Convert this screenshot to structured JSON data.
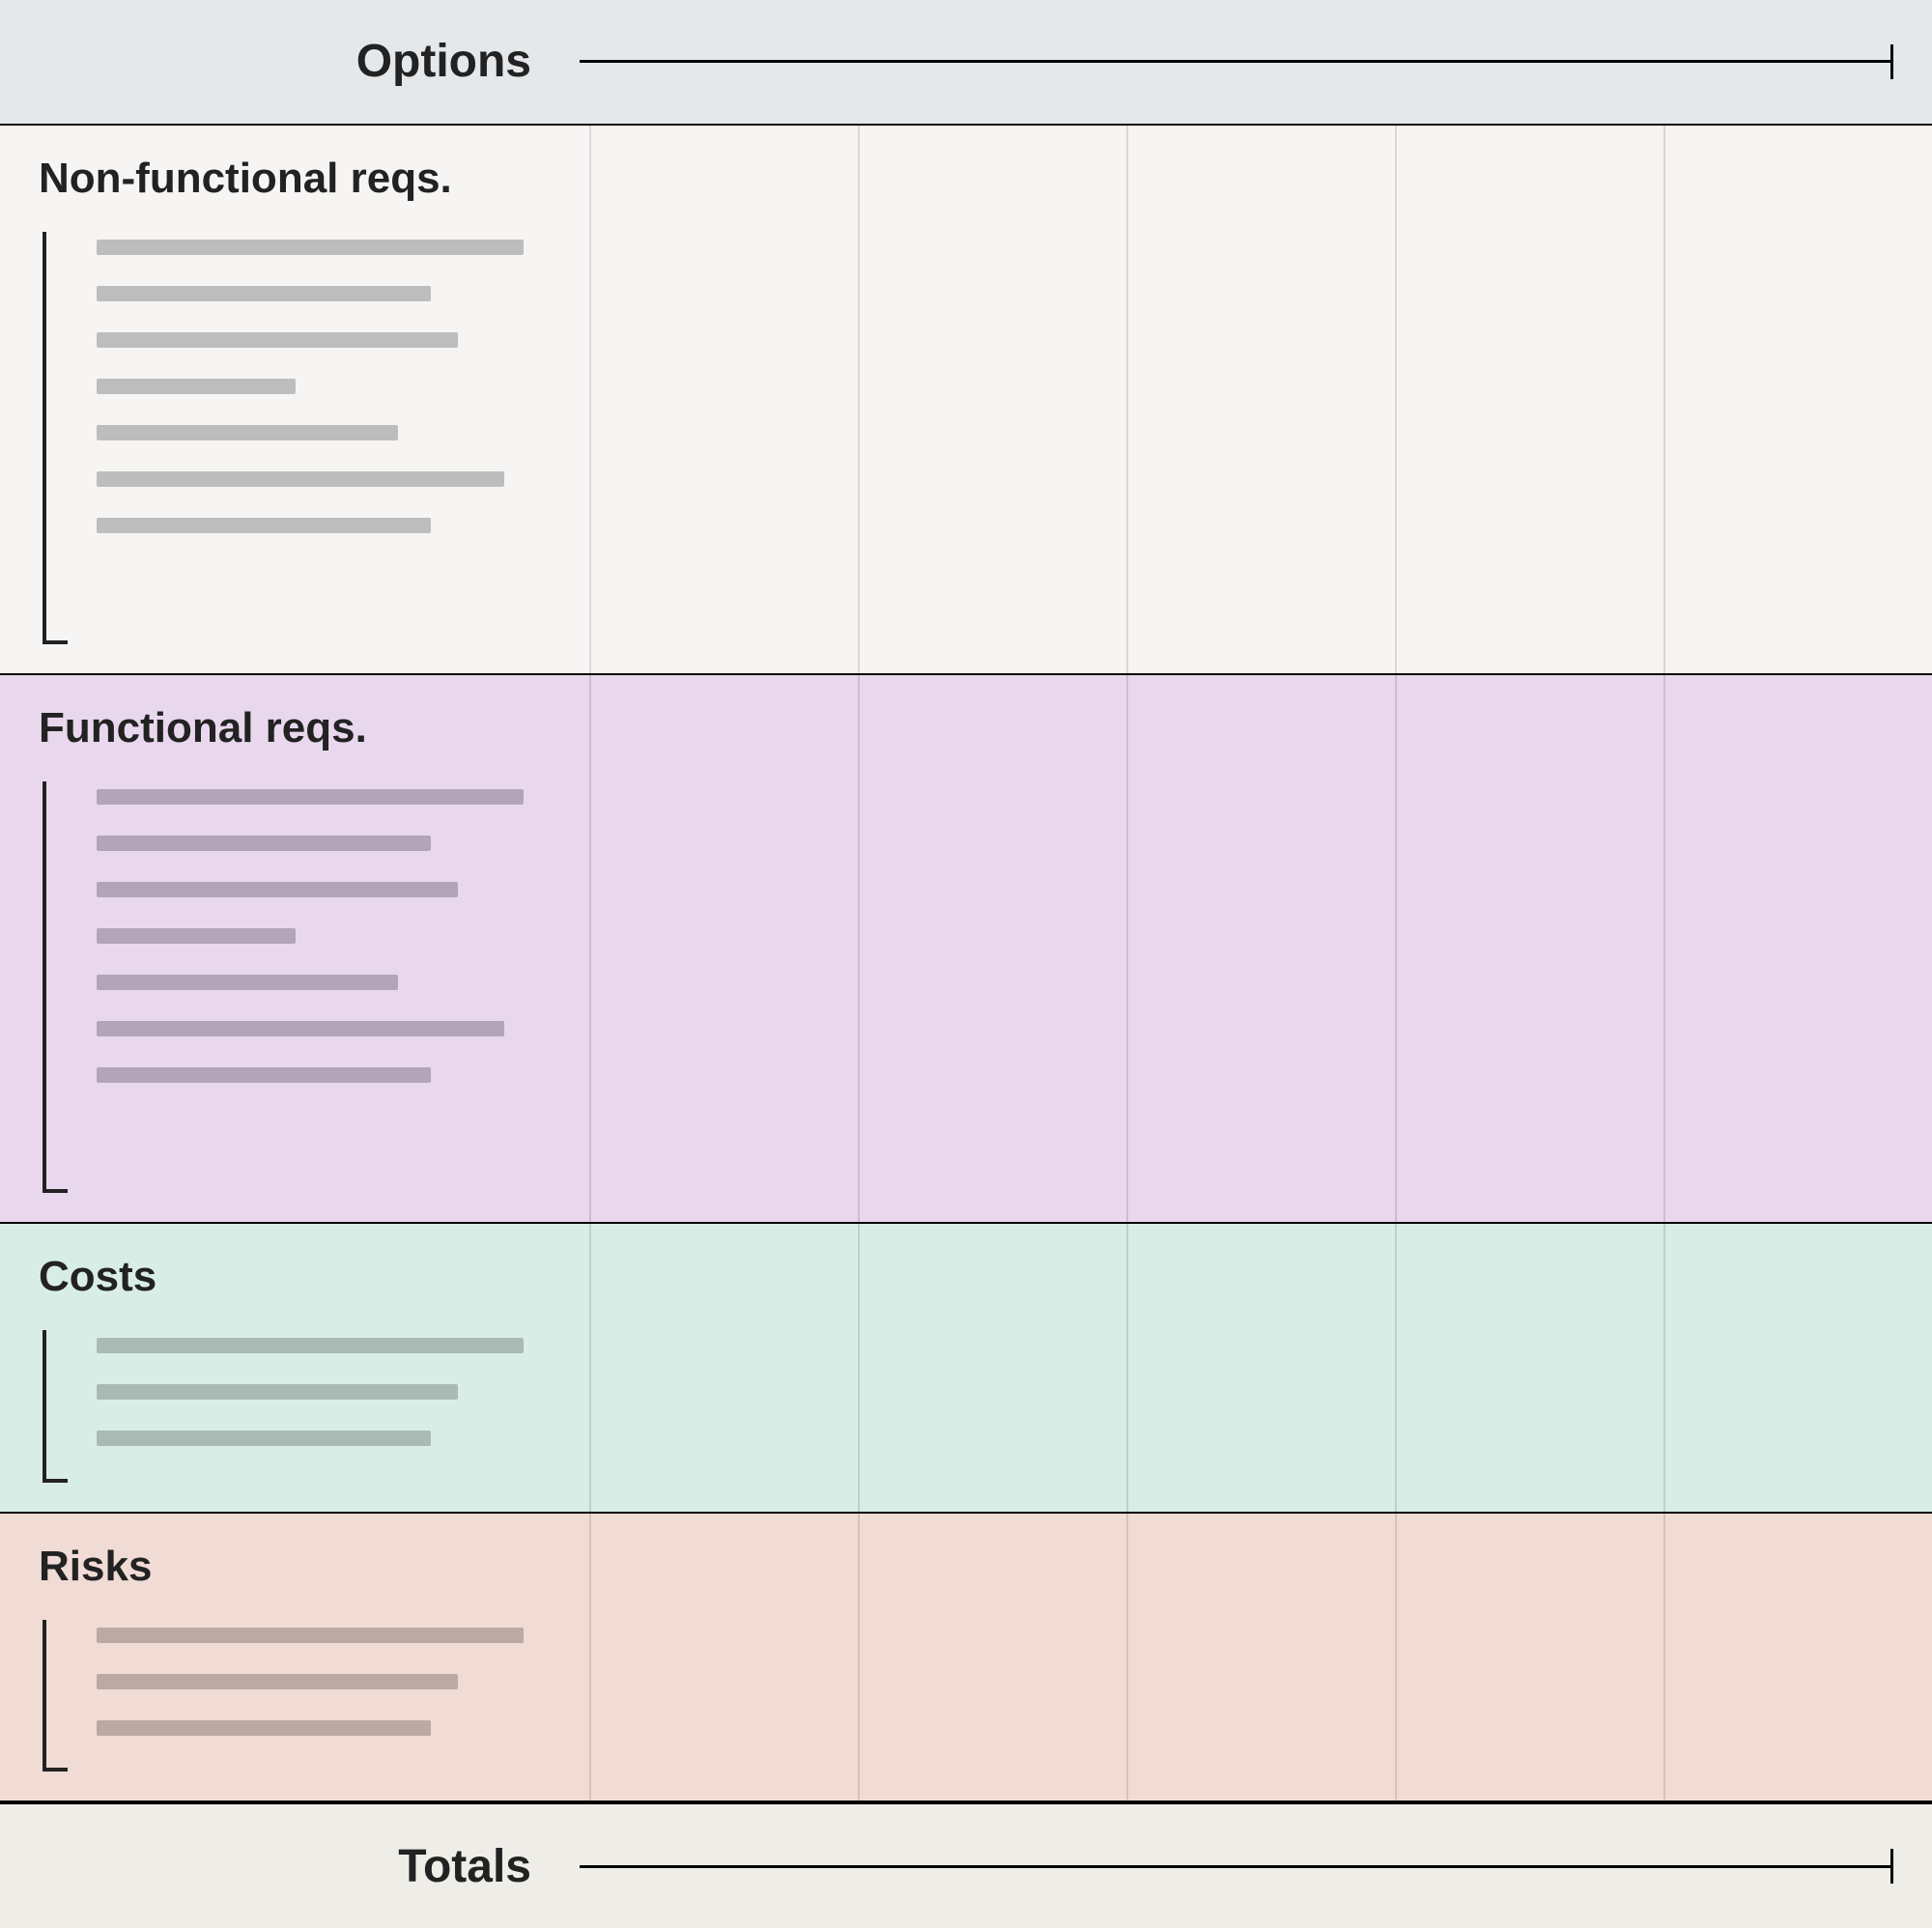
{
  "header": {
    "label": "Options"
  },
  "footer": {
    "label": "Totals"
  },
  "sections": {
    "nonfunctional": {
      "title": "Non-functional reqs.",
      "item_count": 7
    },
    "functional": {
      "title": "Functional reqs.",
      "item_count": 7
    },
    "costs": {
      "title": "Costs",
      "item_count": 3
    },
    "risks": {
      "title": "Risks",
      "item_count": 3
    }
  },
  "option_columns": 5,
  "colors": {
    "header_bg": "#e5e8ea",
    "footer_bg": "#eeede8",
    "nonfunctional_bg": "#f7f5f3",
    "functional_bg": "#e9d8ed",
    "costs_bg": "#d9ede7",
    "risks_bg": "#f0dbd5"
  }
}
